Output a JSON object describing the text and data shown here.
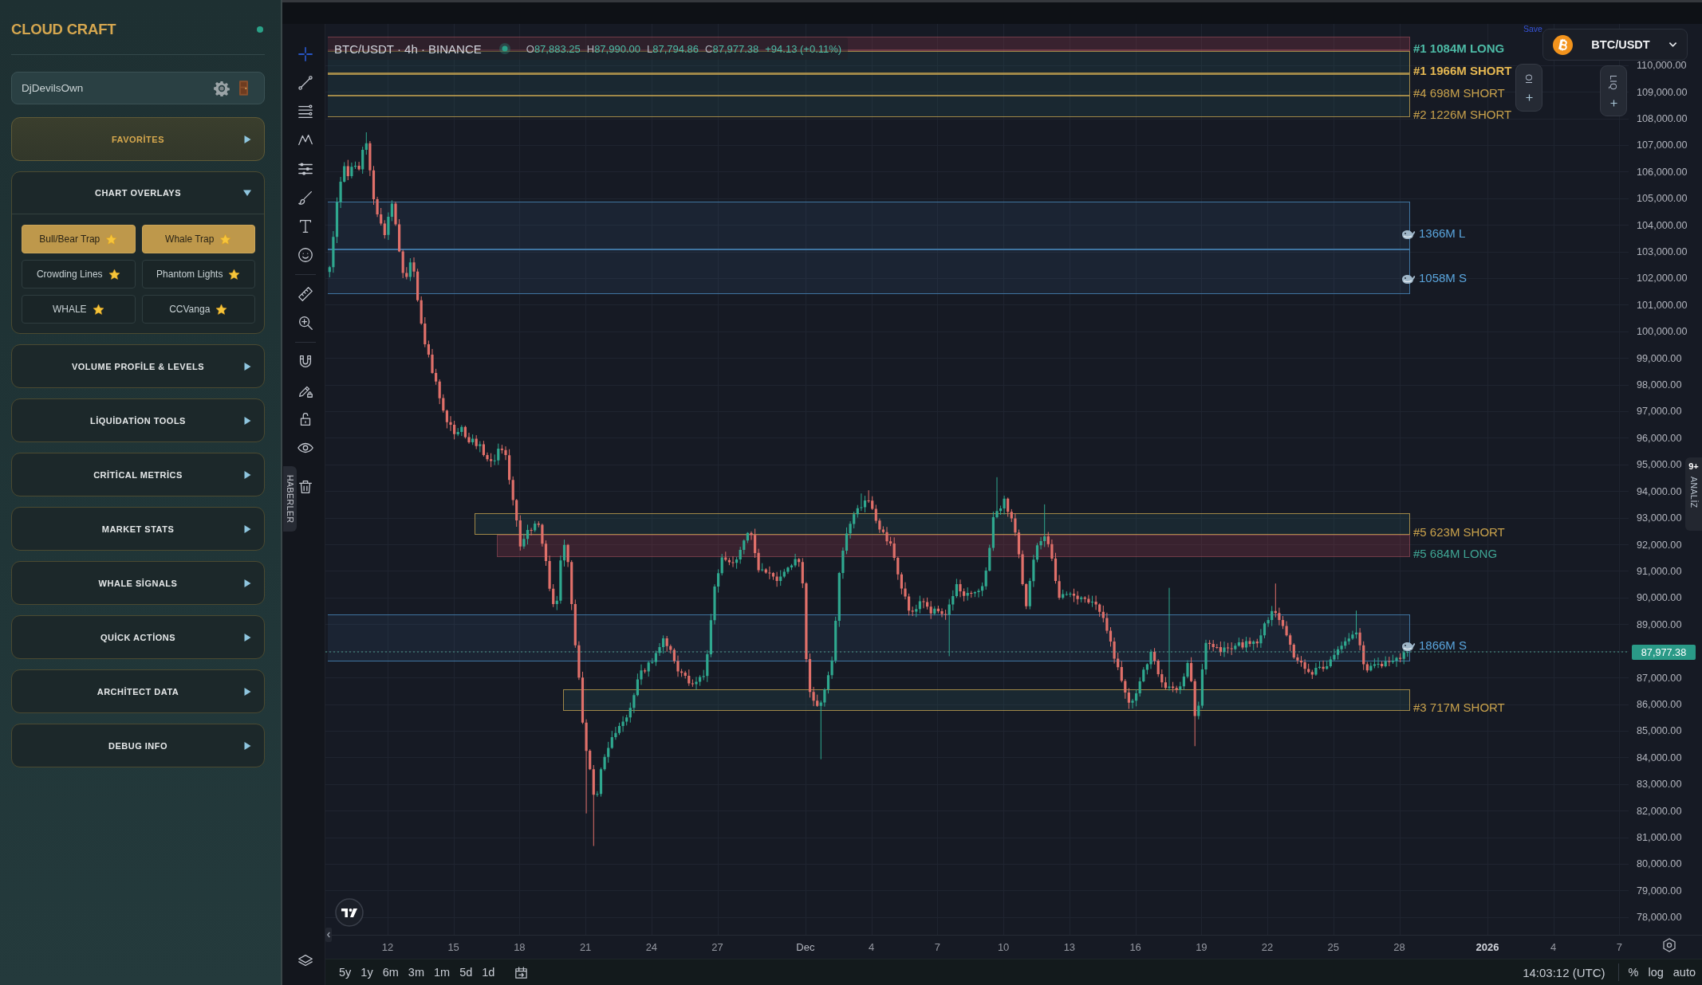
{
  "sidebar": {
    "brand": "CLOUD CRAFT",
    "connected": true,
    "user": {
      "name": "DjDevilsOwn"
    },
    "sections": [
      {
        "title": "FAVORİTES",
        "kind": "favorites",
        "expanded": false
      },
      {
        "title": "CHART OVERLAYS",
        "kind": "section",
        "expanded": true,
        "items": [
          {
            "label": "Bull/Bear Trap",
            "selected": true
          },
          {
            "label": "Whale Trap",
            "selected": true
          },
          {
            "label": "Crowding Lines",
            "selected": false
          },
          {
            "label": "Phantom Lights",
            "selected": false
          },
          {
            "label": "WHALE",
            "selected": false
          },
          {
            "label": "CCVanga",
            "selected": false
          }
        ]
      },
      {
        "title": "VOLUME PROFİLE & LEVELS",
        "kind": "section",
        "expanded": false
      },
      {
        "title": "LİQUİDATİON TOOLS",
        "kind": "section",
        "expanded": false
      },
      {
        "title": "CRİTİCAL METRİCS",
        "kind": "section",
        "expanded": false
      },
      {
        "title": "MARKET STATS",
        "kind": "section",
        "expanded": false
      },
      {
        "title": "WHALE SİGNALS",
        "kind": "section",
        "expanded": false
      },
      {
        "title": "QUİCK ACTİONS",
        "kind": "section",
        "expanded": false
      },
      {
        "title": "ARCHİTECT DATA",
        "kind": "section",
        "expanded": false
      },
      {
        "title": "DEBUG INFO",
        "kind": "section",
        "expanded": false
      }
    ]
  },
  "toolbar": {
    "tools": [
      {
        "selected": true
      },
      {
        "selected": false
      },
      {
        "selected": false
      },
      {
        "selected": false
      },
      {
        "selected": false
      },
      {
        "selected": false
      },
      {
        "selected": false
      },
      {
        "selected": false
      },
      {
        "selected": false
      },
      {
        "selected": false
      },
      {
        "selected": false
      },
      {
        "selected": false
      },
      {
        "selected": false
      },
      {
        "selected": false
      },
      {
        "selected": false
      }
    ],
    "side_tab": "HABERLER"
  },
  "chart": {
    "save_link": "Save",
    "legend": {
      "title": "BTC/USDT · 4h · BINANCE",
      "live": true,
      "ohlc": [
        {
          "label": "O",
          "value": "87,883.25"
        },
        {
          "label": "H",
          "value": "87,990.00"
        },
        {
          "label": "L",
          "value": "87,794.86"
        },
        {
          "label": "C",
          "value": "87,977.38"
        }
      ],
      "change": "+94.13 (+0.11%)"
    },
    "symbol_selector": {
      "symbol": "BTC/USDT"
    },
    "side_buttons": [
      {
        "label": "OI"
      },
      {
        "label": "LIQ"
      }
    ],
    "zones": [
      {
        "label": "#1 1084M LONG",
        "kind": "long",
        "strong": true
      },
      {
        "label": "#1 1966M SHORT",
        "kind": "short",
        "strong": true
      },
      {
        "label": "#4 698M SHORT",
        "kind": "short",
        "strong": false
      },
      {
        "label": "#2 1226M SHORT",
        "kind": "short",
        "strong": false
      },
      {
        "label": "1366M L",
        "kind": "whale",
        "strong": false
      },
      {
        "label": "1058M S",
        "kind": "whale",
        "strong": false
      },
      {
        "label": "#5 623M SHORT",
        "kind": "short",
        "strong": false
      },
      {
        "label": "#5 684M LONG",
        "kind": "long",
        "strong": false
      },
      {
        "label": "1866M S",
        "kind": "whale",
        "strong": false
      },
      {
        "label": "#3 717M SHORT",
        "kind": "short",
        "strong": false
      }
    ],
    "price_axis": [
      "110,000.00",
      "109,000.00",
      "108,000.00",
      "107,000.00",
      "106,000.00",
      "105,000.00",
      "104,000.00",
      "103,000.00",
      "102,000.00",
      "101,000.00",
      "100,000.00",
      "99,000.00",
      "98,000.00",
      "97,000.00",
      "96,000.00",
      "95,000.00",
      "94,000.00",
      "93,000.00",
      "92,000.00",
      "91,000.00",
      "90,000.00",
      "89,000.00",
      "87,000.00",
      "86,000.00",
      "85,000.00",
      "84,000.00",
      "83,000.00",
      "82,000.00",
      "81,000.00",
      "80,000.00",
      "79,000.00",
      "78,000.00"
    ],
    "last_price": "87,977.38",
    "time_axis": [
      {
        "text": "12",
        "kind": "day"
      },
      {
        "text": "15",
        "kind": "day"
      },
      {
        "text": "18",
        "kind": "day"
      },
      {
        "text": "21",
        "kind": "day"
      },
      {
        "text": "24",
        "kind": "day"
      },
      {
        "text": "27",
        "kind": "day"
      },
      {
        "text": "Dec",
        "kind": "month"
      },
      {
        "text": "4",
        "kind": "day"
      },
      {
        "text": "7",
        "kind": "day"
      },
      {
        "text": "10",
        "kind": "day"
      },
      {
        "text": "13",
        "kind": "day"
      },
      {
        "text": "16",
        "kind": "day"
      },
      {
        "text": "19",
        "kind": "day"
      },
      {
        "text": "22",
        "kind": "day"
      },
      {
        "text": "25",
        "kind": "day"
      },
      {
        "text": "28",
        "kind": "day"
      },
      {
        "text": "2026",
        "kind": "year"
      },
      {
        "text": "4",
        "kind": "day"
      },
      {
        "text": "7",
        "kind": "day"
      }
    ],
    "analysis_tab": {
      "badge": "9+",
      "label": "ANALİZ"
    }
  },
  "bottom_bar": {
    "ranges": [
      {
        "label": "5y",
        "selected": false
      },
      {
        "label": "1y",
        "selected": false
      },
      {
        "label": "6m",
        "selected": false
      },
      {
        "label": "3m",
        "selected": false
      },
      {
        "label": "1m",
        "selected": false
      },
      {
        "label": "5d",
        "selected": false
      },
      {
        "label": "1d",
        "selected": false
      }
    ],
    "clock": "14:03:12 (UTC)",
    "scale_options": [
      {
        "label": "%",
        "selected": false
      },
      {
        "label": "log",
        "selected": false
      },
      {
        "label": "auto",
        "selected": false
      }
    ]
  }
}
